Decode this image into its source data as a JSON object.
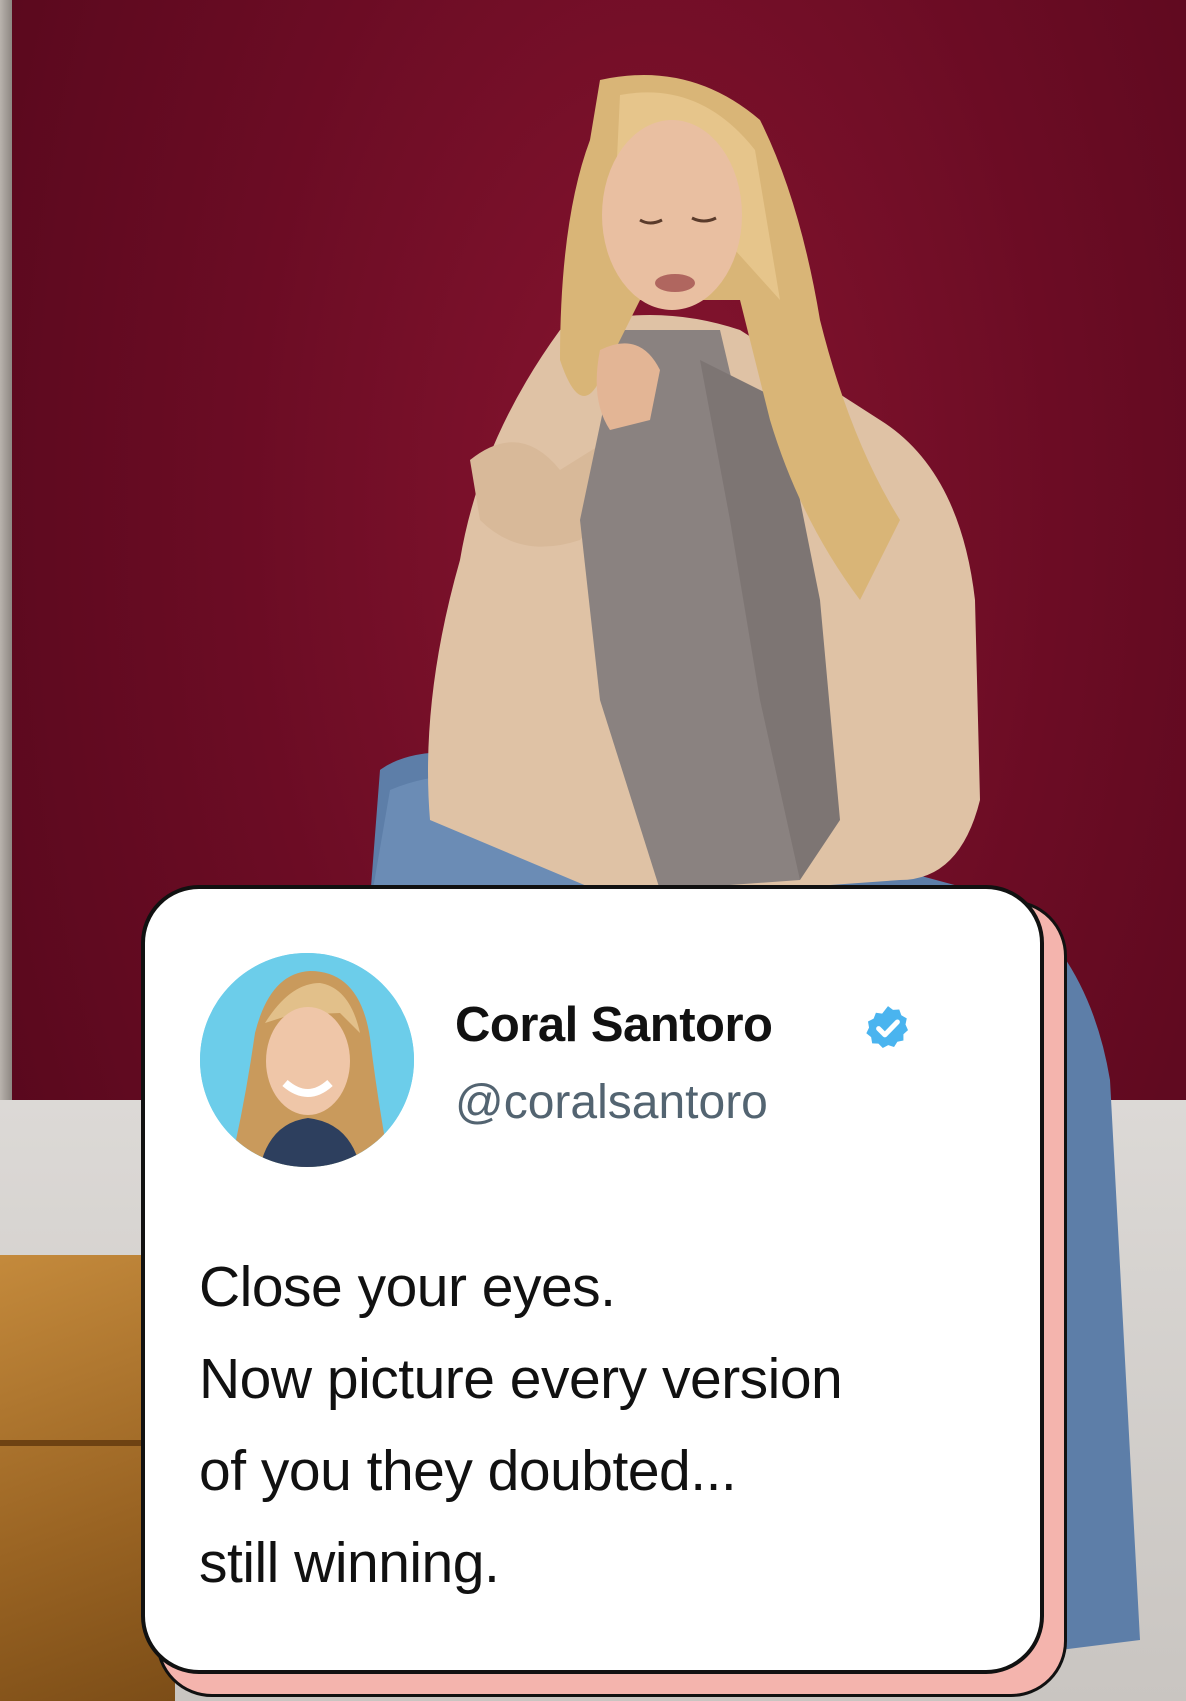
{
  "post": {
    "display_name": "Coral Santoro",
    "handle": "@coralsantoro",
    "verified_icon": "verified-badge-icon",
    "text_lines": [
      "Close your eyes.",
      "Now picture every version",
      "of you they doubted...",
      "still winning."
    ]
  },
  "colors": {
    "background": "#6b0c24",
    "card": "#ffffff",
    "card_shadow": "#f4b4ad",
    "verified": "#4ab4ef",
    "handle": "#536471",
    "avatar_bg": "#6ccdea"
  }
}
